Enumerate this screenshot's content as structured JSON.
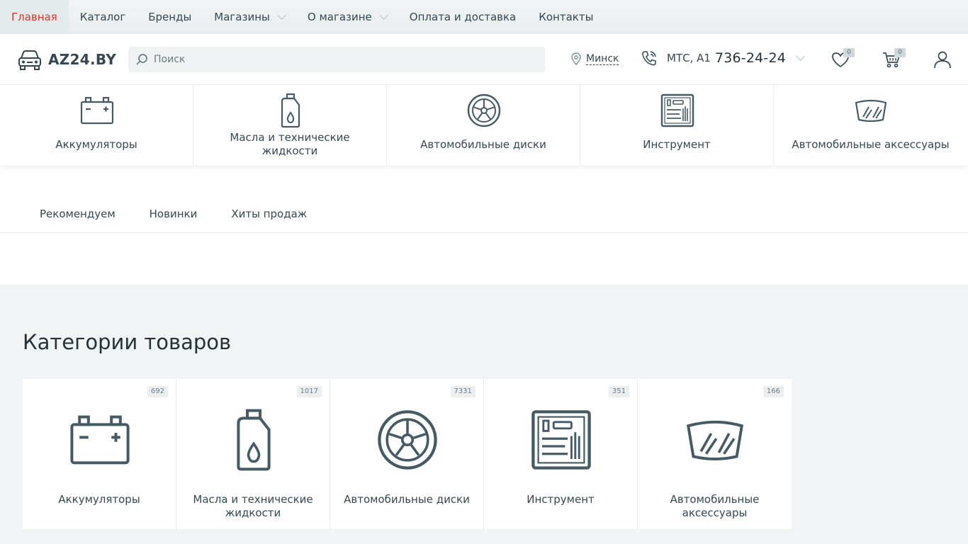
{
  "topnav": {
    "items": [
      {
        "label": "Главная"
      },
      {
        "label": "Каталог"
      },
      {
        "label": "Бренды"
      },
      {
        "label": "Магазины"
      },
      {
        "label": "О магазине"
      },
      {
        "label": "Оплата и доставка"
      },
      {
        "label": "Контакты"
      }
    ]
  },
  "header": {
    "logo_text": "AZ24.BY",
    "search_placeholder": "Поиск",
    "city": "Минск",
    "phone_operators": "МТС, А1",
    "phone_number": "736-24-24",
    "wishlist_count": "0",
    "cart_count": "0"
  },
  "catstrip": {
    "items": [
      {
        "label": "Аккумуляторы",
        "icon": "battery-icon"
      },
      {
        "label": "Масла и технические жидкости",
        "icon": "oil-canister-icon"
      },
      {
        "label": "Автомобильные диски",
        "icon": "wheel-icon"
      },
      {
        "label": "Инструмент",
        "icon": "tool-set-icon"
      },
      {
        "label": "Автомобильные аксессуары",
        "icon": "windshield-icon"
      }
    ]
  },
  "tabs": [
    {
      "label": "Рекомендуем"
    },
    {
      "label": "Новинки"
    },
    {
      "label": "Хиты продаж"
    }
  ],
  "categories": {
    "title": "Категории товаров",
    "items": [
      {
        "label": "Аккумуляторы",
        "count": "692",
        "icon": "battery-icon"
      },
      {
        "label": "Масла и технические жидкости",
        "count": "1017",
        "icon": "oil-canister-icon"
      },
      {
        "label": "Автомобильные диски",
        "count": "7331",
        "icon": "wheel-icon"
      },
      {
        "label": "Инструмент",
        "count": "351",
        "icon": "tool-set-icon"
      },
      {
        "label": "Автомобильные аксессуары",
        "count": "166",
        "icon": "windshield-icon"
      }
    ]
  },
  "colors": {
    "accent": "#d63a2f",
    "text": "#37474f",
    "section_bg": "#f0f4f4"
  }
}
